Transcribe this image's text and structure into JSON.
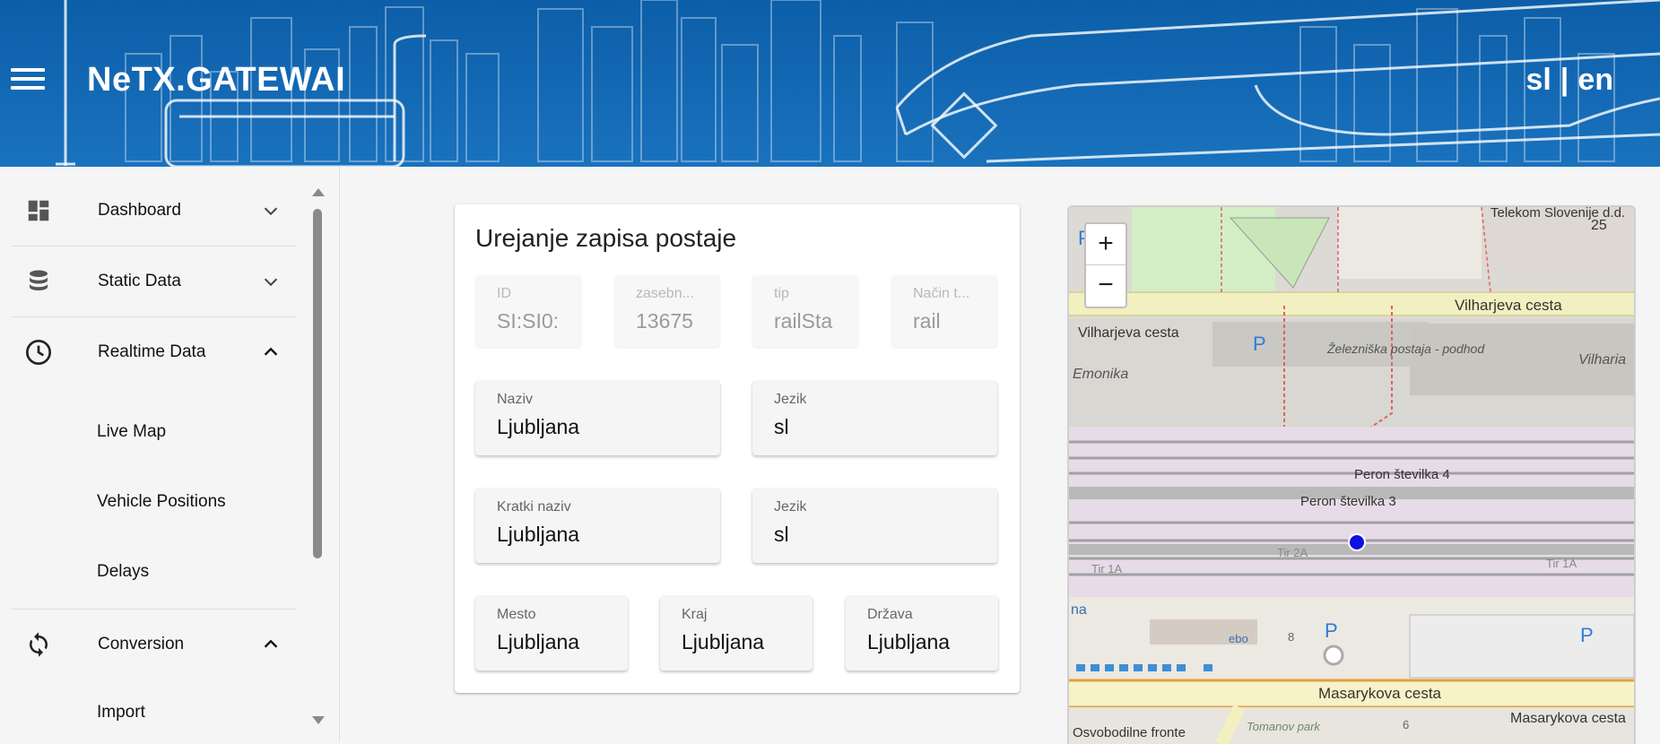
{
  "header": {
    "app_title": "NeTX.GATEWAI",
    "lang_sl": "sl",
    "lang_separator": "|",
    "lang_en": "en",
    "menu_icon": "hamburger-menu-icon"
  },
  "sidebar": {
    "items": [
      {
        "label": "Dashboard",
        "icon": "dashboard-icon",
        "expanded": false
      },
      {
        "label": "Static Data",
        "icon": "database-icon",
        "expanded": false
      },
      {
        "label": "Realtime Data",
        "icon": "clock-icon",
        "expanded": true,
        "children": [
          "Live Map",
          "Vehicle Positions",
          "Delays"
        ]
      },
      {
        "label": "Conversion",
        "icon": "sync-icon",
        "expanded": true,
        "children": [
          "Import"
        ]
      }
    ]
  },
  "form": {
    "title": "Urejanje zapisa postaje",
    "fields": {
      "id": {
        "label": "ID",
        "value": "SI:SI0:"
      },
      "private_code": {
        "label": "zasebn...",
        "value": "13675"
      },
      "type": {
        "label": "tip",
        "value": "railSta"
      },
      "mode": {
        "label": "Način t...",
        "value": "rail"
      },
      "name": {
        "label": "Naziv",
        "value": "Ljubljana"
      },
      "name_lang": {
        "label": "Jezik",
        "value": "sl"
      },
      "short_name": {
        "label": "Kratki naziv",
        "value": "Ljubljana"
      },
      "short_name_lang": {
        "label": "Jezik",
        "value": "sl"
      },
      "city": {
        "label": "Mesto",
        "value": "Ljubljana"
      },
      "region": {
        "label": "Kraj",
        "value": "Ljubljana"
      },
      "country": {
        "label": "Država",
        "value": "Ljubljana"
      }
    }
  },
  "map": {
    "zoom_in": "+",
    "zoom_out": "−",
    "labels": {
      "telekom": "Telekom Slovenije d.d.",
      "num25": "25",
      "vilharjeva_top": "Vilharjeva cesta",
      "vilharjeva_left": "Vilharjeva cesta",
      "emonika": "Emonika",
      "vilharia": "Vilharia",
      "zelezniska": "Železniška postaja - podhod",
      "peron3": "Peron številka 3",
      "peron4": "Peron številka 4",
      "tir2a": "Tir 2A",
      "tir1a_left": "Tir 1A",
      "tir1a_right": "Tir 1A",
      "na": "na",
      "ebo": "ebo",
      "num8": "8",
      "masarykova_center": "Masarykova cesta",
      "masarykova_right": "Masarykova cesta",
      "osvobodilne": "Osvobodilne fronte",
      "tomanov": "Tomanov park",
      "num6": "6",
      "p": "P"
    },
    "colors": {
      "marker": "#1010e0",
      "railway_band": "#e7dbe7",
      "road": "#f2f0c0"
    }
  }
}
